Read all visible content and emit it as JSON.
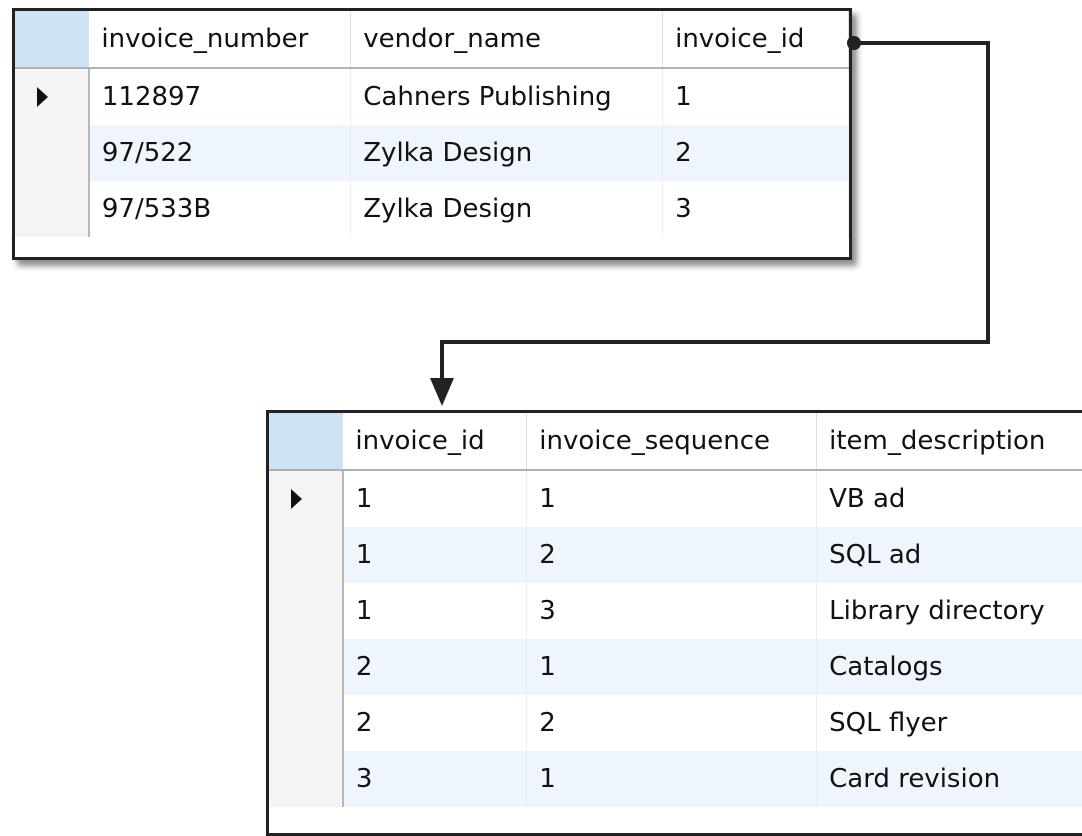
{
  "invoices_grid": {
    "columns": [
      "invoice_number",
      "vendor_name",
      "invoice_id"
    ],
    "rows": [
      [
        "112897",
        "Cahners Publishing",
        "1"
      ],
      [
        "97/522",
        "Zylka Design",
        "2"
      ],
      [
        "97/533B",
        "Zylka Design",
        "3"
      ]
    ],
    "current_row": 0
  },
  "line_items_grid": {
    "columns": [
      "invoice_id",
      "invoice_sequence",
      "item_description"
    ],
    "rows": [
      [
        "1",
        "1",
        "VB ad"
      ],
      [
        "1",
        "2",
        "SQL ad"
      ],
      [
        "1",
        "3",
        "Library directory"
      ],
      [
        "2",
        "1",
        "Catalogs"
      ],
      [
        "2",
        "2",
        "SQL flyer"
      ],
      [
        "3",
        "1",
        "Card revision"
      ]
    ],
    "current_row": 0
  },
  "colors": {
    "corner_header": "#cde3f3",
    "alt_row": "#eef5fc",
    "connector": "#222222"
  },
  "icons": {
    "row_selector": "current-row-arrow-icon",
    "connector": "foreign-key-connector"
  }
}
